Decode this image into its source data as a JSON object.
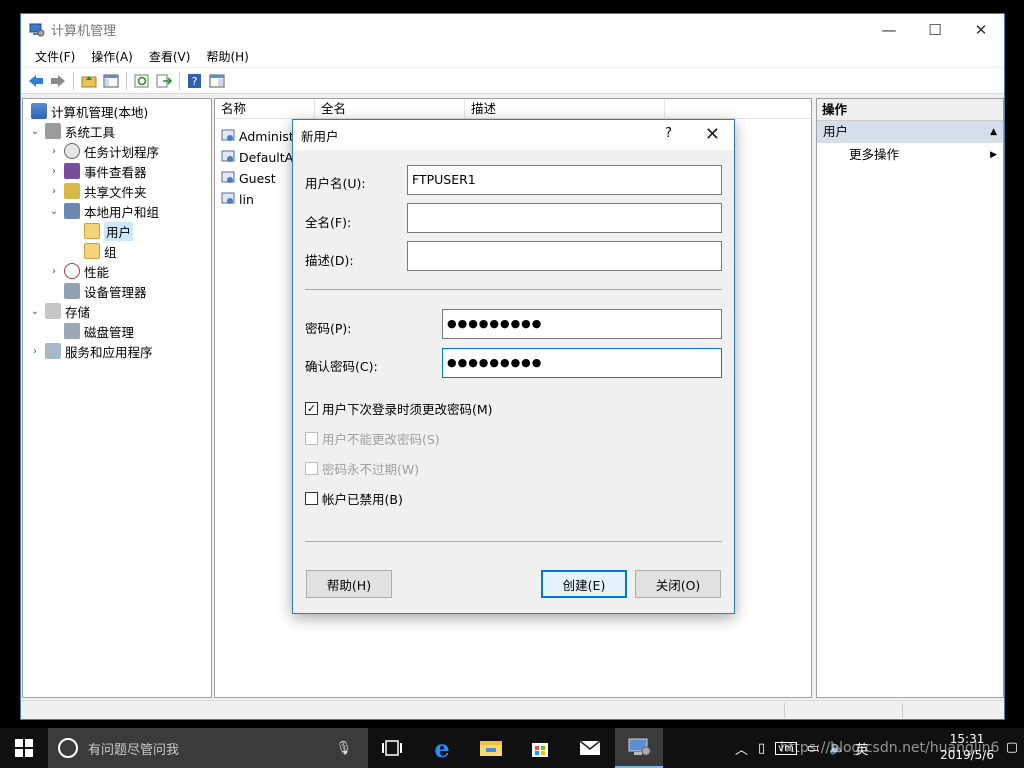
{
  "window": {
    "title": "计算机管理",
    "menu": [
      "文件(F)",
      "操作(A)",
      "查看(V)",
      "帮助(H)"
    ],
    "controls": {
      "minimize": "—",
      "maximize": "☐",
      "close": "✕"
    }
  },
  "tree": [
    {
      "label": "计算机管理(本地)",
      "icon": "computer-management-icon"
    },
    {
      "label": "系统工具",
      "icon": "system-tools-icon"
    },
    {
      "label": "任务计划程序",
      "icon": "task-scheduler-icon"
    },
    {
      "label": "事件查看器",
      "icon": "event-viewer-icon"
    },
    {
      "label": "共享文件夹",
      "icon": "shared-folders-icon"
    },
    {
      "label": "本地用户和组",
      "icon": "local-users-groups-icon"
    },
    {
      "label": "用户",
      "icon": "folder-icon"
    },
    {
      "label": "组",
      "icon": "folder-icon"
    },
    {
      "label": "性能",
      "icon": "performance-icon"
    },
    {
      "label": "设备管理器",
      "icon": "device-manager-icon"
    },
    {
      "label": "存储",
      "icon": "storage-icon"
    },
    {
      "label": "磁盘管理",
      "icon": "disk-management-icon"
    },
    {
      "label": "服务和应用程序",
      "icon": "services-apps-icon"
    }
  ],
  "list": {
    "columns": [
      "名称",
      "全名",
      "描述"
    ],
    "rows": [
      "Administr",
      "DefaultAc",
      "Guest",
      "lin"
    ]
  },
  "actions": {
    "header": "操作",
    "section": "用户",
    "item": "更多操作"
  },
  "dialog": {
    "title": "新用户",
    "help_glyph": "?",
    "close_glyph": "✕",
    "username_label": "用户名(U):",
    "username_value": "FTPUSER1",
    "fullname_label": "全名(F):",
    "fullname_value": "",
    "description_label": "描述(D):",
    "description_value": "",
    "password_label": "密码(P):",
    "password_value": "●●●●●●●●●",
    "confirm_label": "确认密码(C):",
    "confirm_value": "●●●●●●●●●",
    "checkboxes": [
      {
        "label": "用户下次登录时须更改密码(M)",
        "checked": true,
        "enabled": true
      },
      {
        "label": "用户不能更改密码(S)",
        "checked": false,
        "enabled": false
      },
      {
        "label": "密码永不过期(W)",
        "checked": false,
        "enabled": false
      },
      {
        "label": "帐户已禁用(B)",
        "checked": false,
        "enabled": true
      }
    ],
    "help_button": "帮助(H)",
    "create_button": "创建(E)",
    "close_button": "关闭(O)"
  },
  "taskbar": {
    "search_placeholder": "有问题尽管问我",
    "tray_lang": "英",
    "time": "15:31",
    "date": "2019/5/6"
  },
  "watermark": "https://blog.csdn.net/huanglin6"
}
